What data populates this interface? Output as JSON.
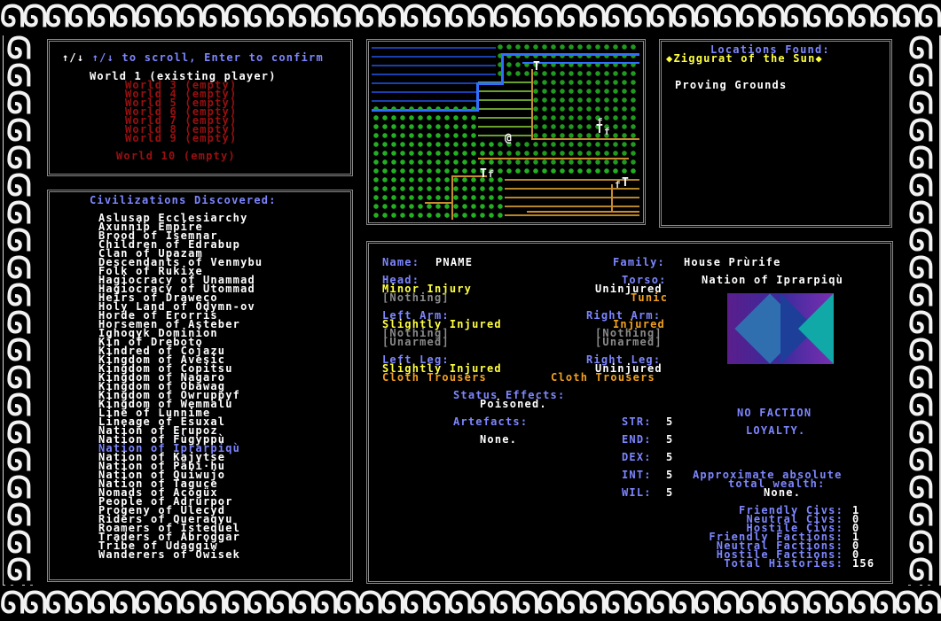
{
  "worlds": {
    "hint": "↑/↓ to scroll, Enter to confirm",
    "items": [
      {
        "label": "World 1 (existing player)",
        "state": "existing"
      },
      {
        "label": "World 3 (empty)",
        "state": "empty"
      },
      {
        "label": "World 4 (empty)",
        "state": "empty"
      },
      {
        "label": "World 5 (empty)",
        "state": "empty"
      },
      {
        "label": "World 6 (empty)",
        "state": "empty"
      },
      {
        "label": "World 7 (empty)",
        "state": "empty"
      },
      {
        "label": "World 8 (empty)",
        "state": "empty"
      },
      {
        "label": "World 9 (empty)",
        "state": "empty"
      },
      {
        "label": "World 10 (empty)",
        "state": "empty"
      }
    ]
  },
  "civs": {
    "title": "Civilizations Discovered:",
    "items": [
      "Aslusap Ecclesiarchy",
      "Axunnip Empire",
      "Brood of Isemnar",
      "Children of Edrabup",
      "Clan of Upazam",
      "Descendants of Venmybu",
      "Folk of Rukixe",
      "Hagiocracy of Unammad",
      "Hagiocracy of Utommad",
      "Heirs of Draweco",
      "Holy Land of Odymn-ov",
      "Horde of Erorris",
      "Horsemen of Asteber",
      "Ighoqyk Dominion",
      "Kin of Dreboto",
      "Kindred of Cojazu",
      "Kingdom of Avesic",
      "Kingdom of Copitsu",
      "Kingdom of Nagaro",
      "Kingdom of Obawag",
      "Kingdom of Owruppyf",
      "Kingdom of Wemmalu",
      "Line of Lunnime",
      "Lineage of Esuxal",
      "Nation of Erupoz",
      "Nation of Fùgyppù",
      "Nation of Iprarpiqù",
      "Nation of Kajytse",
      "Nation of Päbi·hu",
      "Nation of Quiwujo",
      "Nation of Taguce",
      "Nomads of Acogüx",
      "People of Adrurpor",
      "Progeny of Ulecyd",
      "Riders of Queraqyu",
      "Roamers of Istequel",
      "Traders of Abroggar",
      "Tribe of Udaggiw",
      "Wanderers of Owisek"
    ],
    "highlighted": "Nation of Iprarpiqù"
  },
  "locations": {
    "title": "Locations Found:",
    "selected": "Ziggurat of the Sun",
    "items": [
      "Proving Grounds"
    ]
  },
  "character": {
    "name_label": "Name:",
    "name": "PNAME",
    "family_label": "Family:",
    "family": "House Prùrife",
    "nation": "Nation of Iprarpiqù",
    "head_label": "Head:",
    "head_status": "Minor Injury",
    "head_item": "[Nothing]",
    "torso_label": "Torso:",
    "torso_status": "Uninjured",
    "torso_item": "Tunic",
    "left_arm_label": "Left Arm:",
    "left_arm_status": "Slightly Injured",
    "left_arm_item1": "[Nothing]",
    "left_arm_item2": "[Unarmed]",
    "right_arm_label": "Right Arm:",
    "right_arm_status": "Injured",
    "right_arm_item1": "[Nothing]",
    "right_arm_item2": "[Unarmed]",
    "left_leg_label": "Left Leg:",
    "left_leg_status": "Slightly Injured",
    "left_leg_item": "Cloth Trousers",
    "right_leg_label": "Right Leg:",
    "right_leg_status": "Uninjured",
    "right_leg_item": "Cloth Trousers",
    "status_label": "Status Effects:",
    "status_value": "Poisoned.",
    "artefacts_label": "Artefacts:",
    "artefacts_value": "None.",
    "stats": [
      {
        "label": "STR:",
        "value": "5"
      },
      {
        "label": "END:",
        "value": "5"
      },
      {
        "label": "DEX:",
        "value": "5"
      },
      {
        "label": "INT:",
        "value": "5"
      },
      {
        "label": "WIL:",
        "value": "5"
      }
    ],
    "faction_line1": "NO FACTION",
    "faction_line2": "LOYALTY.",
    "wealth_line1": "Approximate absolute",
    "wealth_line2": "total wealth:",
    "wealth_value": "None.",
    "summary": [
      {
        "label": "Friendly Civs:",
        "value": "1"
      },
      {
        "label": "Neutral Civs:",
        "value": "0"
      },
      {
        "label": "Hostile Civs:",
        "value": "0"
      },
      {
        "label": "Friendly Factions:",
        "value": "1"
      },
      {
        "label": "Neutral Factions:",
        "value": "0"
      },
      {
        "label": "Hostile Factions:",
        "value": "0"
      },
      {
        "label": "Total Histories:",
        "value": "156"
      }
    ]
  },
  "map": {
    "player_glyph": "@",
    "town_glyph": "T",
    "farm_glyph": "f"
  },
  "colors": {
    "accent_blue": "#7d86ff",
    "empty_red": "#9a1010",
    "injury_yellow": "#ffff40",
    "item_orange": "#f0a020"
  }
}
